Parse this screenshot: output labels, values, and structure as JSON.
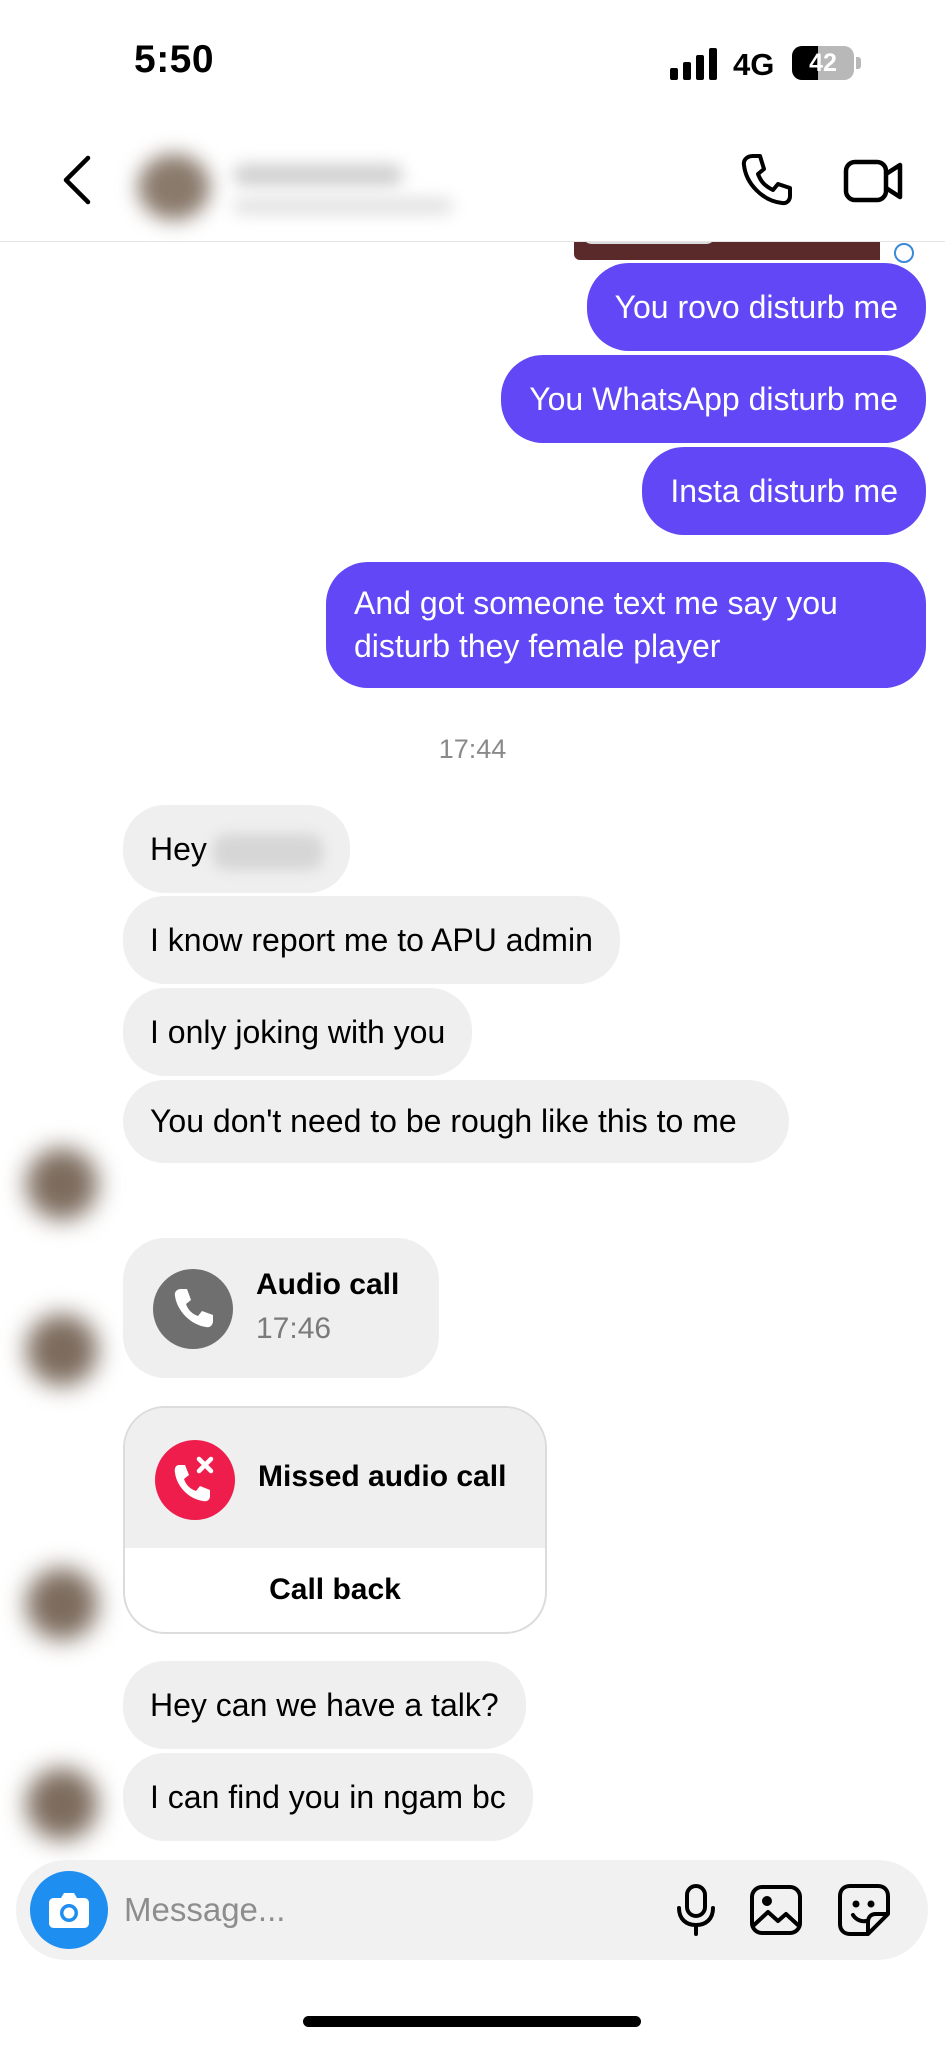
{
  "status_bar": {
    "time": "5:50",
    "network": "4G",
    "battery": "42",
    "battery_level": 0.42
  },
  "header": {
    "contact_name": "",
    "actions": [
      "phone-icon",
      "video-icon"
    ]
  },
  "messages": {
    "outgoing": [
      "You rovo disturb me",
      "You WhatsApp disturb me",
      "Insta disturb me",
      "And got someone text me say you disturb they female player"
    ],
    "timestamp": "17:44",
    "incoming": [
      "Hey",
      "I know report me to APU admin",
      "I only joking with you",
      "You don't need to be rough like this to me"
    ],
    "audio_call": {
      "title": "Audio call",
      "time": "17:46"
    },
    "missed_call": {
      "title": "Missed audio call",
      "action": "Call back"
    },
    "incoming_later": [
      "Hey can we have a talk?",
      "I can find you in ngam bc"
    ]
  },
  "composer": {
    "placeholder": "Message..."
  },
  "colors": {
    "outgoing_bubble": "#6147f5",
    "incoming_bubble": "#efefef",
    "missed_call_red": "#ee1d4c",
    "camera_blue": "#1f8ef1"
  }
}
